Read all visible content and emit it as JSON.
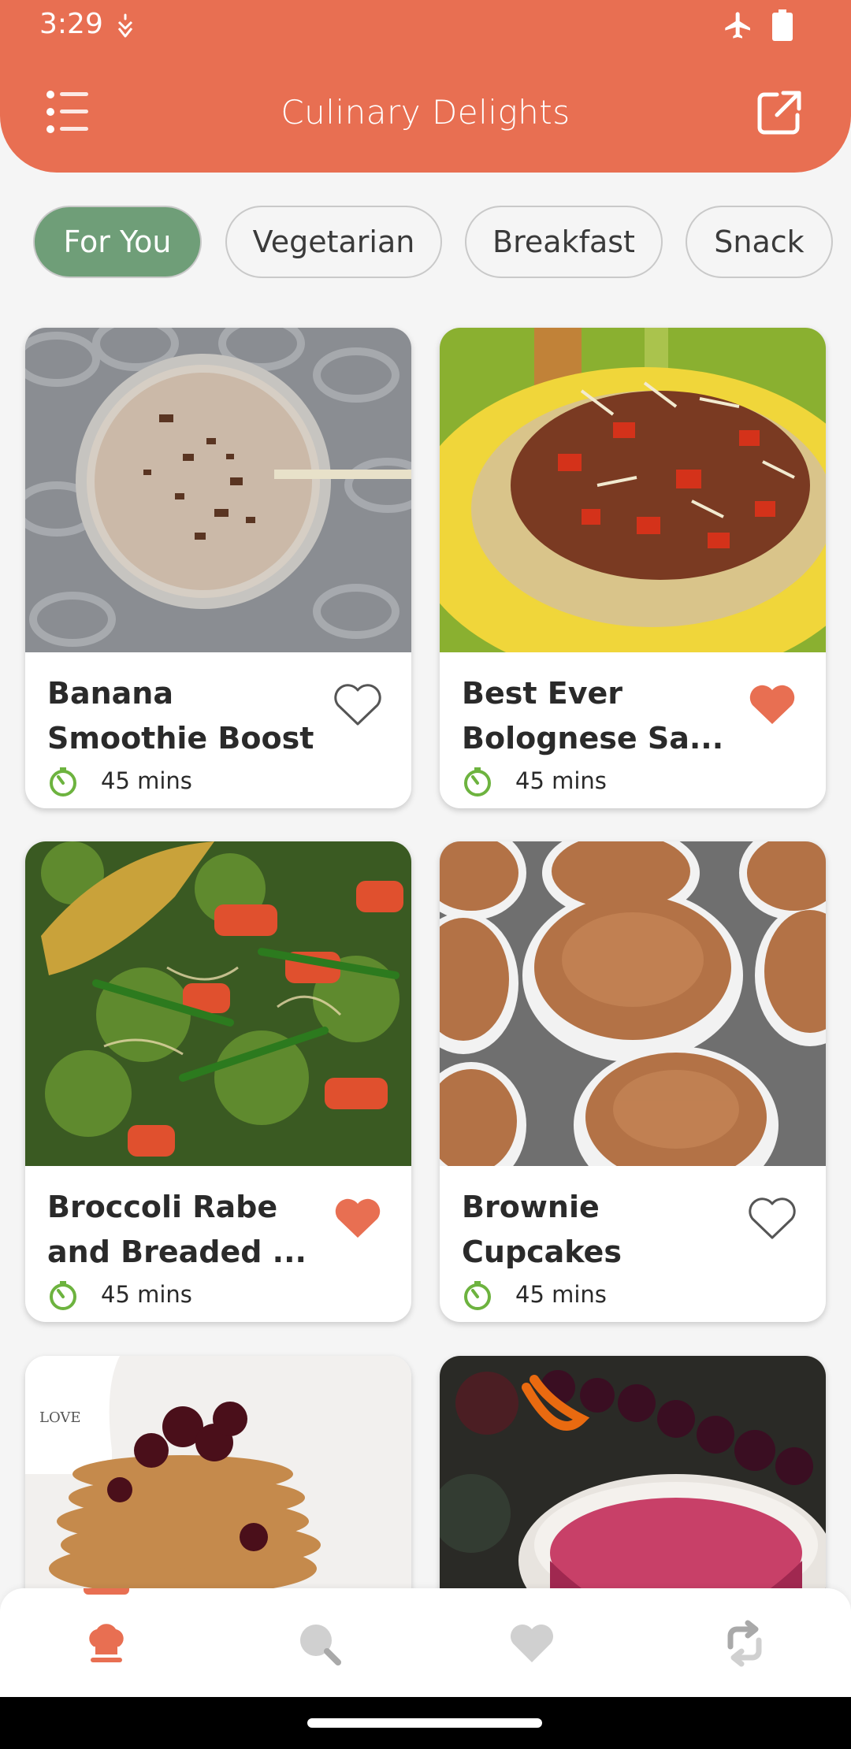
{
  "status_bar": {
    "time": "3:29",
    "icons": [
      "notification-icon",
      "airplane-mode-icon",
      "battery-icon"
    ]
  },
  "header": {
    "title": "Culinary Delights",
    "left_icon": "menu-icon",
    "right_icon": "share-external-icon",
    "background_color": "#E86F52"
  },
  "categories": [
    {
      "label": "For You",
      "active": true
    },
    {
      "label": "Vegetarian",
      "active": false
    },
    {
      "label": "Breakfast",
      "active": false
    },
    {
      "label": "Snack",
      "active": false
    }
  ],
  "recipes": [
    {
      "title": "Banana\nSmoothie Boost",
      "time": "45 mins",
      "favorite": false,
      "image": "banana-smoothie-photo"
    },
    {
      "title": "Best Ever\nBolognese Sa...",
      "time": "45 mins",
      "favorite": true,
      "image": "bolognese-photo"
    },
    {
      "title": "Broccoli Rabe\nand Breaded ...",
      "time": "45 mins",
      "favorite": true,
      "image": "broccoli-rabe-photo"
    },
    {
      "title": "Brownie\nCupcakes",
      "time": "45 mins",
      "favorite": false,
      "image": "brownie-cupcakes-photo"
    },
    {
      "title": "",
      "time": "",
      "favorite": false,
      "image": "pancakes-photo"
    },
    {
      "title": "",
      "time": "",
      "favorite": false,
      "image": "cranberry-drink-photo"
    }
  ],
  "bottom_nav": [
    {
      "icon": "chef-hat-icon",
      "active": true
    },
    {
      "icon": "search-icon",
      "active": false
    },
    {
      "icon": "heart-icon",
      "active": false
    },
    {
      "icon": "refresh-icon",
      "active": false
    }
  ],
  "colors": {
    "accent": "#E86F52",
    "chip_active": "#6F9E78",
    "timer_green": "#6DB33F",
    "heart_filled": "#E86F52"
  }
}
